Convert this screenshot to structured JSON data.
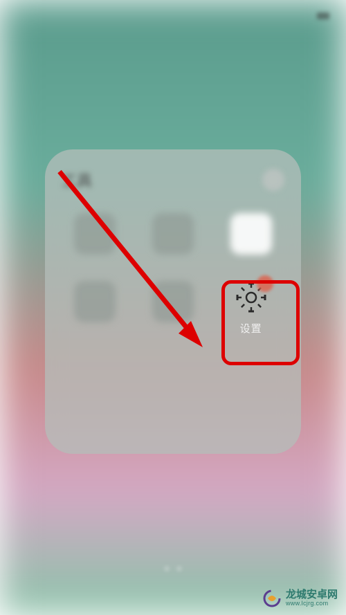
{
  "status": {
    "left_text": "",
    "center_text": "",
    "right_text": ""
  },
  "folder": {
    "title": "工具",
    "items": [
      {
        "label": ""
      },
      {
        "label": ""
      },
      {
        "label": ""
      },
      {
        "label": ""
      },
      {
        "label": ""
      },
      {
        "label": "设置"
      }
    ]
  },
  "annotation": {
    "highlight_target": "settings-app",
    "arrow_color": "#dd0000"
  },
  "watermark": {
    "name": "龙城安卓网",
    "url": "www.lcjrg.com"
  }
}
